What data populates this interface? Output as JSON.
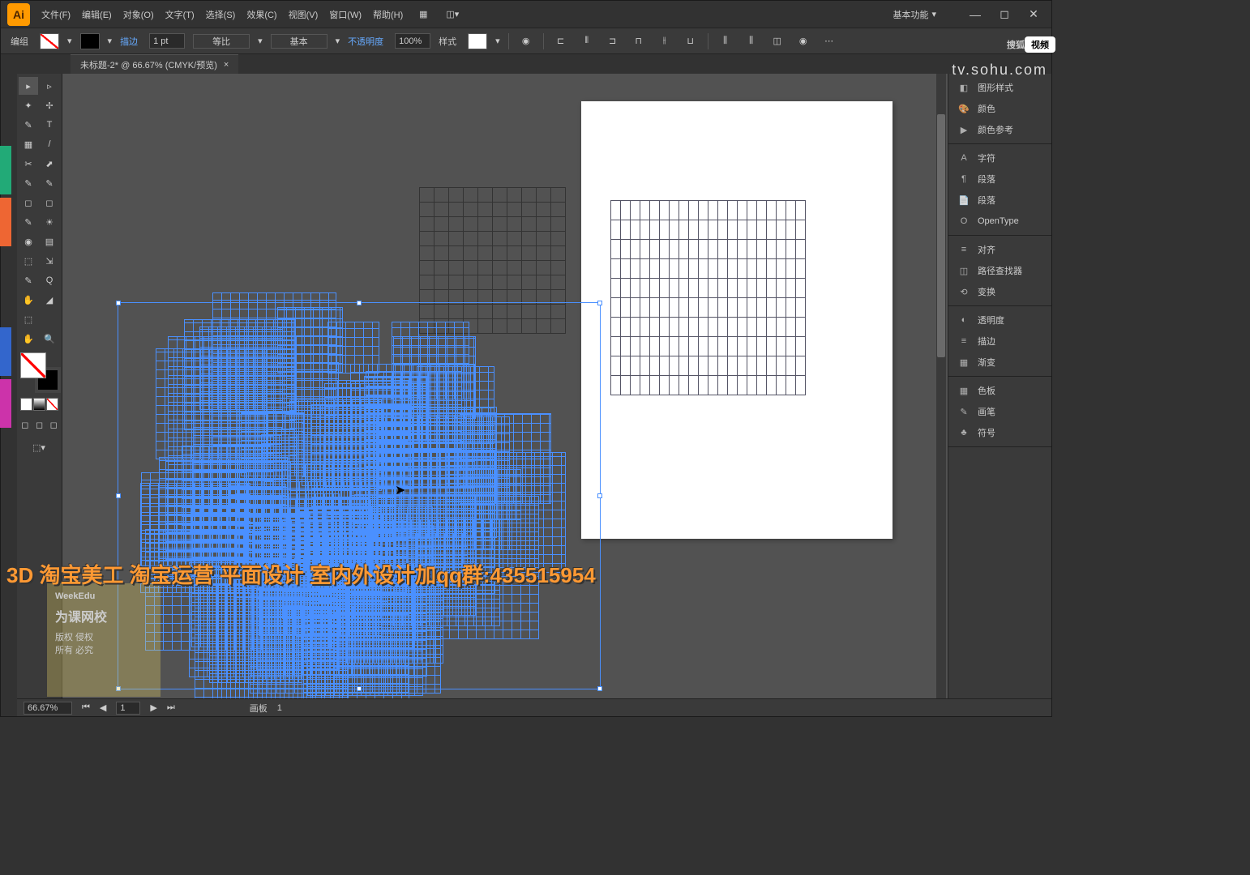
{
  "menubar": {
    "items": [
      "文件(F)",
      "编辑(E)",
      "对象(O)",
      "文字(T)",
      "选择(S)",
      "效果(C)",
      "视图(V)",
      "窗口(W)",
      "帮助(H)"
    ],
    "workspace": "基本功能"
  },
  "controlbar": {
    "label": "编组",
    "stroke_label": "描边",
    "stroke_weight": "1 pt",
    "dash1": "等比",
    "dash2": "基本",
    "opacity_label": "不透明度",
    "opacity": "100%",
    "style_label": "样式"
  },
  "tab": {
    "title": "未标题-2* @ 66.67% (CMYK/预览)"
  },
  "statusbar": {
    "zoom": "66.67%",
    "artboard_label": "画板",
    "artboard_num": "1"
  },
  "right_panels": {
    "group1": [
      {
        "icon": "◧",
        "label": "图形样式"
      },
      {
        "icon": "🎨",
        "label": "颜色"
      },
      {
        "icon": "▶",
        "label": "颜色参考"
      }
    ],
    "group2": [
      {
        "icon": "A",
        "label": "字符"
      },
      {
        "icon": "¶",
        "label": "段落"
      },
      {
        "icon": "📄",
        "label": "段落"
      },
      {
        "icon": "O",
        "label": "OpenType"
      }
    ],
    "group3": [
      {
        "icon": "≡",
        "label": "对齐"
      },
      {
        "icon": "◫",
        "label": "路径查找器"
      },
      {
        "icon": "⟲",
        "label": "变换"
      }
    ],
    "group4": [
      {
        "icon": "◐",
        "label": "透明度"
      },
      {
        "icon": "≡",
        "label": "描边"
      },
      {
        "icon": "▦",
        "label": "渐变"
      }
    ],
    "group5": [
      {
        "icon": "▦",
        "label": "色板"
      },
      {
        "icon": "✎",
        "label": "画笔"
      },
      {
        "icon": "♣",
        "label": "符号"
      }
    ]
  },
  "overlay": "3D 淘宝美工 淘宝运营 平面设计 室内外设计加qq群:435515954",
  "sohu": {
    "brand": "搜狐",
    "box": "视频",
    "url": "tv.sohu.com"
  },
  "watermark": {
    "l1": "WeekEdu",
    "l2": "为课网校",
    "l3": "版权  侵权",
    "l4": "所有  必究"
  },
  "tools_left": [
    "▸",
    "✦",
    "✎",
    "▦",
    "✂",
    "✎",
    "◻",
    "✎",
    "◉",
    "⬚",
    "✎",
    "✋",
    "⬚"
  ],
  "tools_right": [
    "▹",
    "✢",
    "T",
    "/",
    "⬈",
    "✎",
    "◻",
    "☀",
    "▤",
    "⇲",
    "Q",
    "◢"
  ]
}
